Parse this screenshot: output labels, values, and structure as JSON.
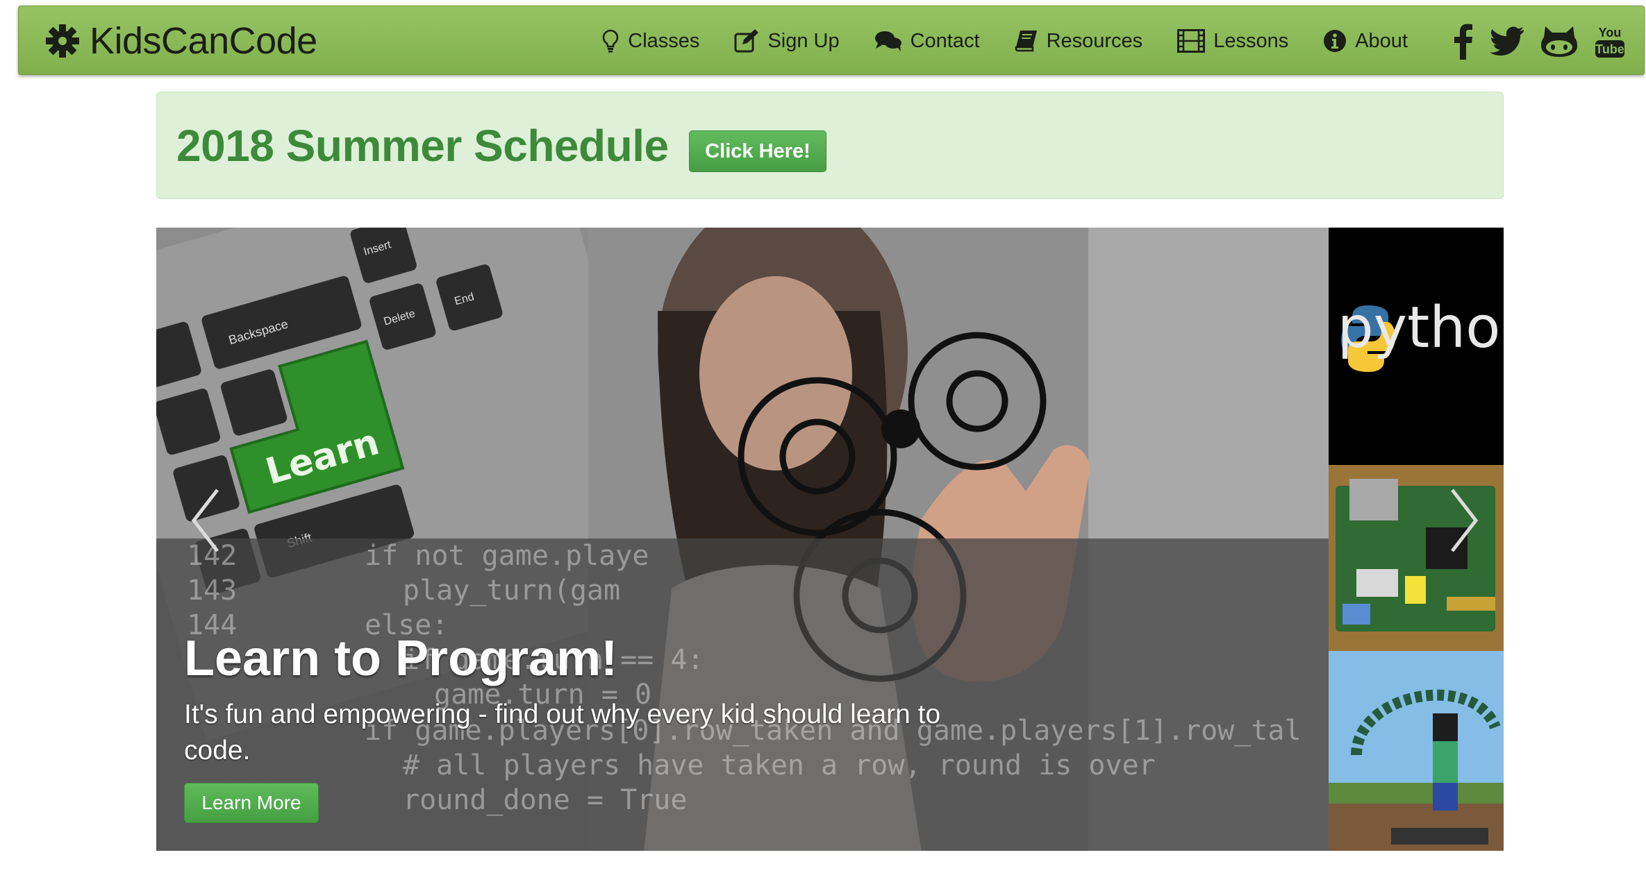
{
  "brand": {
    "name": "KidsCanCode"
  },
  "nav": {
    "items": [
      {
        "label": "Classes",
        "icon": "lightbulb-icon"
      },
      {
        "label": "Sign Up",
        "icon": "edit-icon"
      },
      {
        "label": "Contact",
        "icon": "comments-icon"
      },
      {
        "label": "Resources",
        "icon": "book-icon"
      },
      {
        "label": "Lessons",
        "icon": "film-icon"
      },
      {
        "label": "About",
        "icon": "info-circle-icon"
      }
    ],
    "social": [
      {
        "icon": "facebook-icon"
      },
      {
        "icon": "twitter-icon"
      },
      {
        "icon": "github-icon"
      },
      {
        "icon": "youtube-icon",
        "text_top": "You",
        "text_bottom": "Tube"
      }
    ]
  },
  "alert": {
    "title": "2018 Summer Schedule",
    "button_label": "Click Here!"
  },
  "carousel": {
    "key_label": "Learn",
    "keys": {
      "backspace": "Backspace",
      "insert": "Insert",
      "delete": "Delete",
      "end": "End",
      "shift": "Shift"
    },
    "python_label": "python",
    "code_lines": [
      "if not game.playe",
      "play_turn(gam",
      "else:",
      "if game.turn == 4:",
      "game.turn = 0",
      "if game.players[0].row_taken and game.players[1].row_tal",
      "# all players have taken a row, round is over",
      "round_done = True"
    ],
    "line_numbers": [
      "142",
      "143",
      "144"
    ],
    "caption": {
      "title": "Learn to Program!",
      "text": "It's fun and empowering - find out why every kid should learn to code.",
      "button_label": "Learn More"
    }
  },
  "colors": {
    "navbar": "#8dbb5a",
    "alert_bg": "#dff0d8",
    "alert_text": "#3c8a3a",
    "button_green": "#4fa84b"
  }
}
